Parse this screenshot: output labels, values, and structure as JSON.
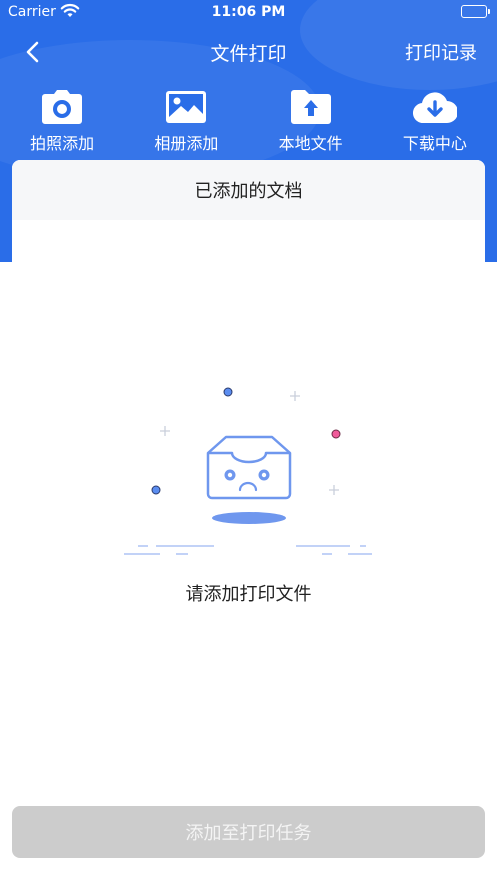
{
  "status_bar": {
    "carrier": "Carrier",
    "time": "11:06 PM"
  },
  "nav": {
    "title": "文件打印",
    "right_link": "打印记录",
    "back_icon": "chevron-left-icon"
  },
  "actions": [
    {
      "label": "拍照添加",
      "icon": "camera-icon"
    },
    {
      "label": "相册添加",
      "icon": "image-icon"
    },
    {
      "label": "本地文件",
      "icon": "folder-upload-icon"
    },
    {
      "label": "下载中心",
      "icon": "cloud-download-icon"
    }
  ],
  "card": {
    "title": "已添加的文档"
  },
  "empty_state": {
    "message": "请添加打印文件",
    "illustration": "empty-box-illustration"
  },
  "bottom_button": {
    "label": "添加至打印任务",
    "enabled": false
  },
  "colors": {
    "brand": "#2a6de8",
    "disabled_button": "#cccccc",
    "illustration_blue": "#5b8df0"
  }
}
